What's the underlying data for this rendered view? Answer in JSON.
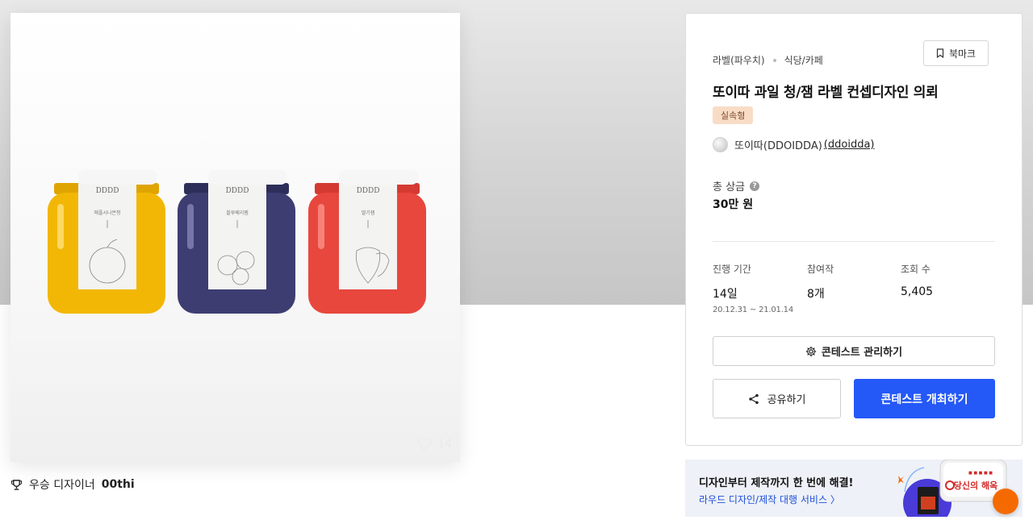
{
  "gallery": {
    "likes": "14",
    "jars": [
      {
        "name": "yellow-jar",
        "label": "애플시나몬청",
        "color": "#F2B705"
      },
      {
        "name": "navy-jar",
        "label": "블루베리잼",
        "color": "#3D3D72"
      },
      {
        "name": "red-jar",
        "label": "딸기잼",
        "color": "#E8473E"
      }
    ],
    "brand_mark": "DDDD"
  },
  "winner": {
    "label": "우승 디자이너",
    "name": "00thi",
    "icon": "trophy-icon"
  },
  "contest": {
    "category": "라벨(파우치)",
    "subcategory": "식당/카페",
    "bookmark_label": "북마크",
    "title": "또이따 과일 청/잼 라벨 컨셉디자인 의뢰",
    "badge": "실속형",
    "host_name": "또이따(DDOIDDA)",
    "host_id": "(ddoidda)",
    "prize_label": "총 상금",
    "prize_value": "30만 원",
    "stats": {
      "duration_label": "진행 기간",
      "duration_value": "14일",
      "duration_range": "20.12.31 ~ 21.01.14",
      "entries_label": "참여작",
      "entries_value": "8개",
      "views_label": "조회 수",
      "views_value": "5,405"
    },
    "manage_label": "콘테스트 관리하기",
    "share_label": "공유하기",
    "open_label": "콘테스트 개최하기"
  },
  "banner": {
    "headline": "디자인부터 제작까지 한 번에 해결!",
    "link": "라우드 디자인/제작 대행 서비스 〉",
    "sign_text": "당신의 해옥"
  },
  "colors": {
    "primary": "#2458F7",
    "badge_bg": "#F9DCC6",
    "fab": "#F56A00"
  }
}
